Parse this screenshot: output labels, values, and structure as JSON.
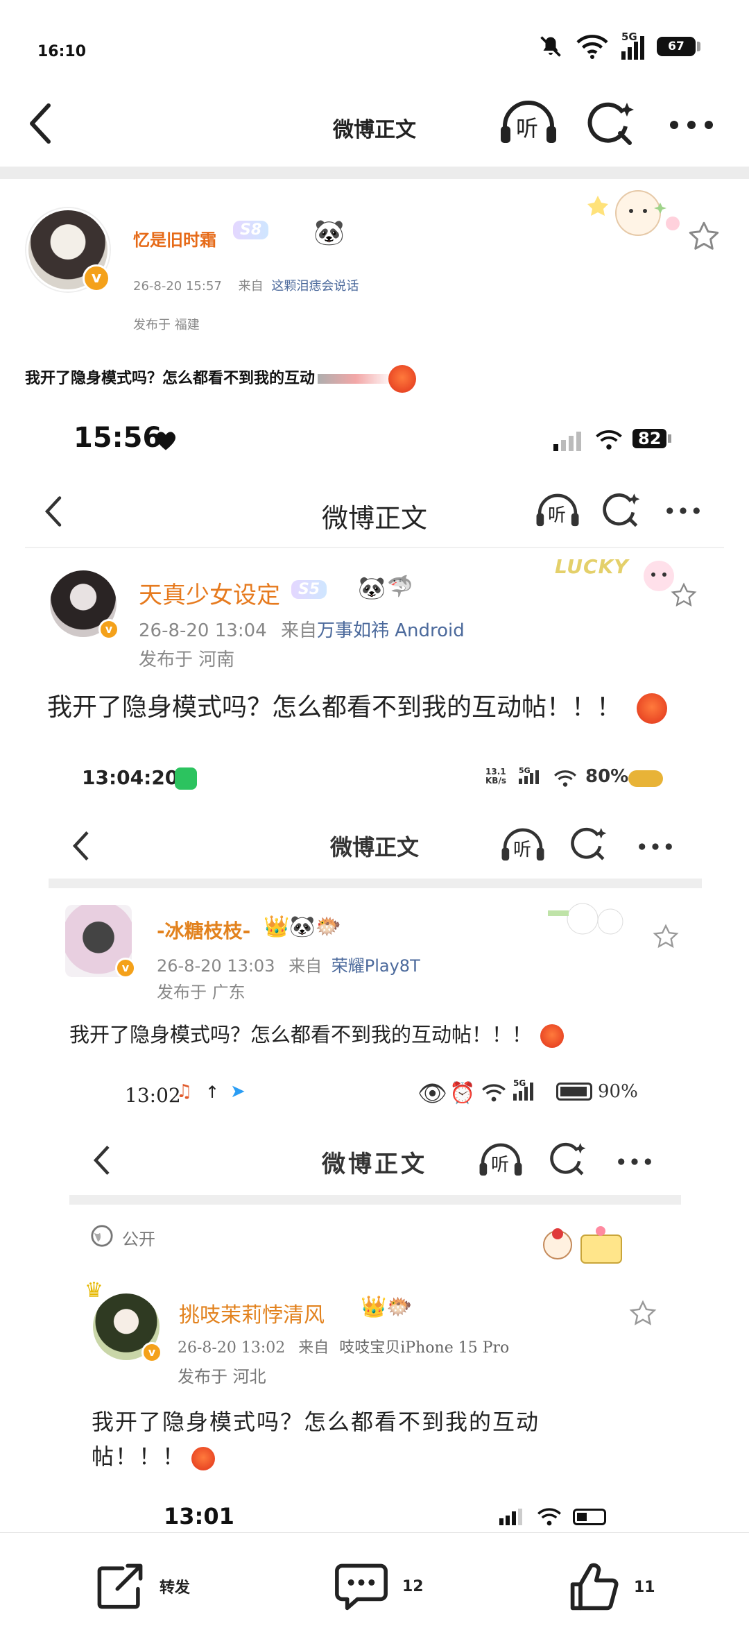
{
  "status": {
    "time": "16:10",
    "network": "5G",
    "battery": "67"
  },
  "nav": {
    "title": "微博正文",
    "listen_label": "听"
  },
  "post": {
    "username": "忆是旧时霜",
    "level_badge": "S8",
    "timestamp": "26-8-20 15:57",
    "source_prefix": "来自",
    "source": "这颗泪痣会说话",
    "location": "发布于 福建",
    "text": "我开了隐身模式吗？怎么都看不到我的互动"
  },
  "shot1": {
    "time": "15:56",
    "battery": "82",
    "title": "微博正文",
    "listen_label": "听",
    "username": "天真少女设定",
    "level_badge": "S5",
    "timestamp": "26-8-20 13:04",
    "source_prefix": "来自",
    "source": "万事如祎 Android",
    "location": "发布于 河南",
    "text": "我开了隐身模式吗？怎么都看不到我的互动帖！！！",
    "sticker": "LUCKY"
  },
  "shot2": {
    "time": "13:04:20",
    "speed": "13.1 KB/s",
    "network": "5G",
    "battery": "80%",
    "title": "微博正文",
    "listen_label": "听",
    "username": "-冰糖枝枝-",
    "timestamp": "26-8-20 13:03",
    "source_prefix": "来自",
    "source": "荣耀Play8T",
    "location": "发布于 广东",
    "text": "我开了隐身模式吗？怎么都看不到我的互动帖！！！"
  },
  "shot3": {
    "time": "13:02",
    "network": "5G",
    "battery": "90%",
    "title": "微博正文",
    "listen_label": "听",
    "visibility": "公开",
    "username": "挑吱茉莉悖清风",
    "timestamp": "26-8-20 13:02",
    "source_prefix": "来自",
    "source": "吱吱宝贝iPhone 15 Pro",
    "location": "发布于 河北",
    "text_line1": "我开了隐身模式吗？怎么都看不到我的互动",
    "text_line2": "帖！！！"
  },
  "shot4": {
    "time": "13:01"
  },
  "toolbar": {
    "repost_label": "转发",
    "comment_count": "12",
    "like_count": "11"
  },
  "colors": {
    "username": "#e66a17",
    "source_link": "#4c6a9c",
    "badge": "#b9a6ff",
    "separator": "#ececec"
  }
}
